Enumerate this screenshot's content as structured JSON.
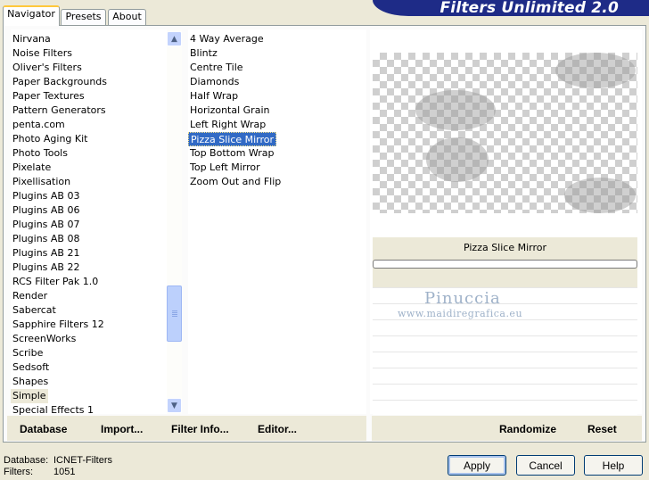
{
  "tabs": [
    "Navigator",
    "Presets",
    "About"
  ],
  "banner_title": "Filters Unlimited 2.0",
  "categories": [
    "Nirvana",
    "Noise Filters",
    "Oliver's Filters",
    "Paper Backgrounds",
    "Paper Textures",
    "Pattern Generators",
    "penta.com",
    "Photo Aging Kit",
    "Photo Tools",
    "Pixelate",
    "Pixellisation",
    "Plugins AB 03",
    "Plugins AB 06",
    "Plugins AB 07",
    "Plugins AB 08",
    "Plugins AB 21",
    "Plugins AB 22",
    "RCS Filter Pak 1.0",
    "Render",
    "Sabercat",
    "Sapphire Filters 12",
    "ScreenWorks",
    "Scribe",
    "Sedsoft",
    "Shapes",
    "Simple",
    "Special Effects 1"
  ],
  "selected_category": "Simple",
  "filters": [
    "4 Way Average",
    "Blintz",
    "Centre Tile",
    "Diamonds",
    "Half Wrap",
    "Horizontal Grain",
    "Left Right Wrap",
    "Pizza Slice Mirror",
    "Top Bottom Wrap",
    "Top Left Mirror",
    "Zoom Out and Flip"
  ],
  "selected_filter": "Pizza Slice Mirror",
  "left_links": {
    "database": "Database",
    "import": "Import...",
    "filter_info": "Filter Info...",
    "editor": "Editor..."
  },
  "right_links": {
    "randomize": "Randomize",
    "reset": "Reset"
  },
  "preview_label": "Pizza Slice Mirror",
  "watermark": {
    "name": "Pinuccia",
    "url": "www.maidiregrafica.eu"
  },
  "status": {
    "database_label": "Database:",
    "database_value": "ICNET-Filters",
    "filters_label": "Filters:",
    "filters_value": "1051"
  },
  "buttons": {
    "apply": "Apply",
    "cancel": "Cancel",
    "help": "Help"
  },
  "colors": {
    "banner": "#1e2b87",
    "selection": "#316ac5",
    "window": "#ece9d8"
  }
}
